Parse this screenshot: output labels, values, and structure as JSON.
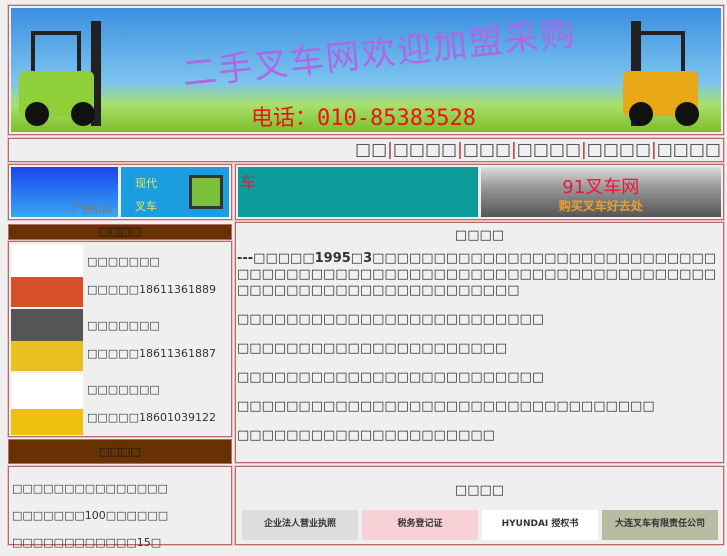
{
  "banner": {
    "slogan": "二手叉车网欢迎加盟采购",
    "phone": "电话：010-85383528"
  },
  "nav": [
    "□□",
    "□□□□",
    "□□□",
    "□□□□",
    "□□□□",
    "□□□□"
  ],
  "ads": {
    "ad1": "广告招商",
    "ad2_line1": "现代",
    "ad2_line2": "叉车",
    "teal_text": "车",
    "yard_title": "91叉车网",
    "yard_sub": "购买叉车好去处"
  },
  "sidebar": {
    "header1": "□□□□",
    "items": [
      {
        "name": "□□□□□□□",
        "phone": "□□□□□18611361889",
        "color": "#d8502a"
      },
      {
        "name": "□□□□□□□",
        "phone": "□□□□□18611361887",
        "color": "#e8c020"
      },
      {
        "name": "□□□□□□□",
        "phone": "□□□□□18601039122",
        "color": "#f0c010"
      }
    ],
    "header2": "□□□□",
    "contact": [
      "□□□□□□□□□□□□□□□",
      "□□□□□□□100□□□□□□",
      "□□□□□□□□□□□□15□"
    ]
  },
  "main": {
    "title": "□□□□",
    "paragraphs": [
      "---□□□□□1995□3□□□□□□□□□□□□□□□□□□□□□□□□□□□□□□□□□□□□□□□□□□□□□□□□□□□□□□□□□□□□□□□□□□□□□□□□□□□□□□□□□□□□□□□□□□",
      "□□□□□□□□□□□□□□□□□□□□□□□□□",
      "□□□□□□□□□□□□□□□□□□□□□□",
      "□□□□□□□□□□□□□□□□□□□□□□□□□",
      "□□□□□□□□□□□□□□□□□□□□□□□□□□□□□□□□□□",
      "□□□□□□□□□□□□□□□□□□□□□"
    ]
  },
  "honor": {
    "title": "□□□□",
    "certs": [
      "企业法人营业执照",
      "税务登记证",
      "HYUNDAI 授权书",
      "大连叉车有限责任公司"
    ]
  }
}
